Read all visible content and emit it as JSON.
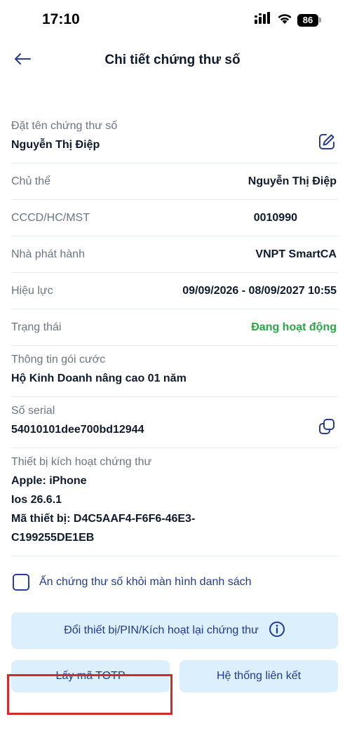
{
  "status_bar": {
    "time": "17:10",
    "battery": "86",
    "icons": [
      "signal-icon",
      "wifi-icon",
      "battery-icon"
    ]
  },
  "header": {
    "title": "Chi tiết chứng thư số",
    "back_icon": "arrow-left-icon"
  },
  "certificate_name": {
    "label": "Đặt tên chứng thư số",
    "value": "Nguyễn Thị Điệp",
    "icon": "edit-icon"
  },
  "details": [
    {
      "label": "Chủ thể",
      "value": "Nguyễn Thị Điệp"
    },
    {
      "label": "CCCD/HC/MST",
      "value": "0010990"
    },
    {
      "label": "Nhà phát hành",
      "value": "VNPT SmartCA"
    },
    {
      "label": "Hiệu lực",
      "value": "09/09/2026 - 08/09/2027 10:55"
    },
    {
      "label": "Trạng thái",
      "value": "Đang hoạt động"
    }
  ],
  "package": {
    "label": "Thông tin gói cước",
    "value": "Hộ Kinh Doanh nâng cao 01 năm"
  },
  "serial": {
    "label": "Số serial",
    "value": "54010101dee700bd12944",
    "icon": "copy-icon"
  },
  "device": {
    "label": "Thiết bị kích hoạt chứng thư",
    "lines": [
      "Apple: iPhone",
      "Ios 26.6.1",
      "Mã thiết bị: D4C5AAF4-F6F6-46E3-",
      "C199255DE1EB"
    ]
  },
  "hide_option": {
    "label": "Ẩn chứng thư số khỏi màn hình danh sách",
    "checked": false
  },
  "actions": {
    "change_device": "Đổi thiết bị/PIN/Kích hoạt lại chứng thư",
    "get_totp": "Lấy mã TOTP",
    "linked_systems": "Hệ thống liên kết"
  },
  "colors": {
    "accent": "#1f3a93",
    "button_bg": "#dceffd",
    "active_status": "#27a843",
    "highlight": "#d42a2a"
  }
}
